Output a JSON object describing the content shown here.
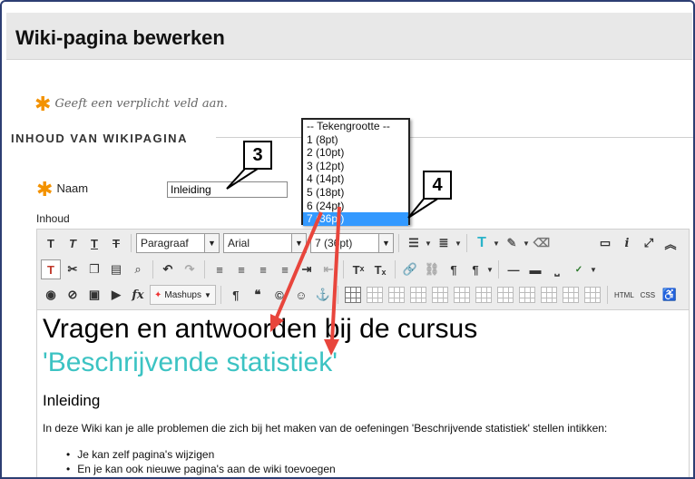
{
  "page_title": "Wiki-pagina bewerken",
  "required_note": "Geeft een verplicht veld aan.",
  "section_title": "INHOUD VAN WIKIPAGINA",
  "name_field": {
    "label": "Naam",
    "value": "Inleiding"
  },
  "content_label": "Inhoud",
  "toolbar": {
    "paragraph_select": "Paragraaf",
    "font_select": "Arial",
    "size_select": "7 (36pt)",
    "mashups_label": "Mashups",
    "html_label": "HTML",
    "css_label": "CSS"
  },
  "font_size_dropdown": {
    "options": [
      "-- Tekengrootte --",
      "1 (8pt)",
      "2 (10pt)",
      "3 (12pt)",
      "4 (14pt)",
      "5 (18pt)",
      "6 (24pt)",
      "7 (36pt)"
    ],
    "selected": "7 (36pt)"
  },
  "editor": {
    "heading_line1": "Vragen en antwoorden bij de cursus",
    "heading_line2": "'Beschrijvende statistiek'",
    "subheading": "Inleiding",
    "paragraph": "In deze Wiki kan je alle problemen die zich bij het maken van de oefeningen 'Beschrijvende statistiek' stellen intikken:",
    "bullets": [
      "Je kan zelf pagina's wijzigen",
      "En je kan ook nieuwe pagina's aan de wiki toevoegen"
    ]
  },
  "callouts": {
    "three": "3",
    "four": "4"
  },
  "colors": {
    "accent_orange": "#f39200",
    "teal_heading": "#3cc3c3",
    "highlight_blue": "#3399ff",
    "arrow_red": "#e8453c"
  }
}
